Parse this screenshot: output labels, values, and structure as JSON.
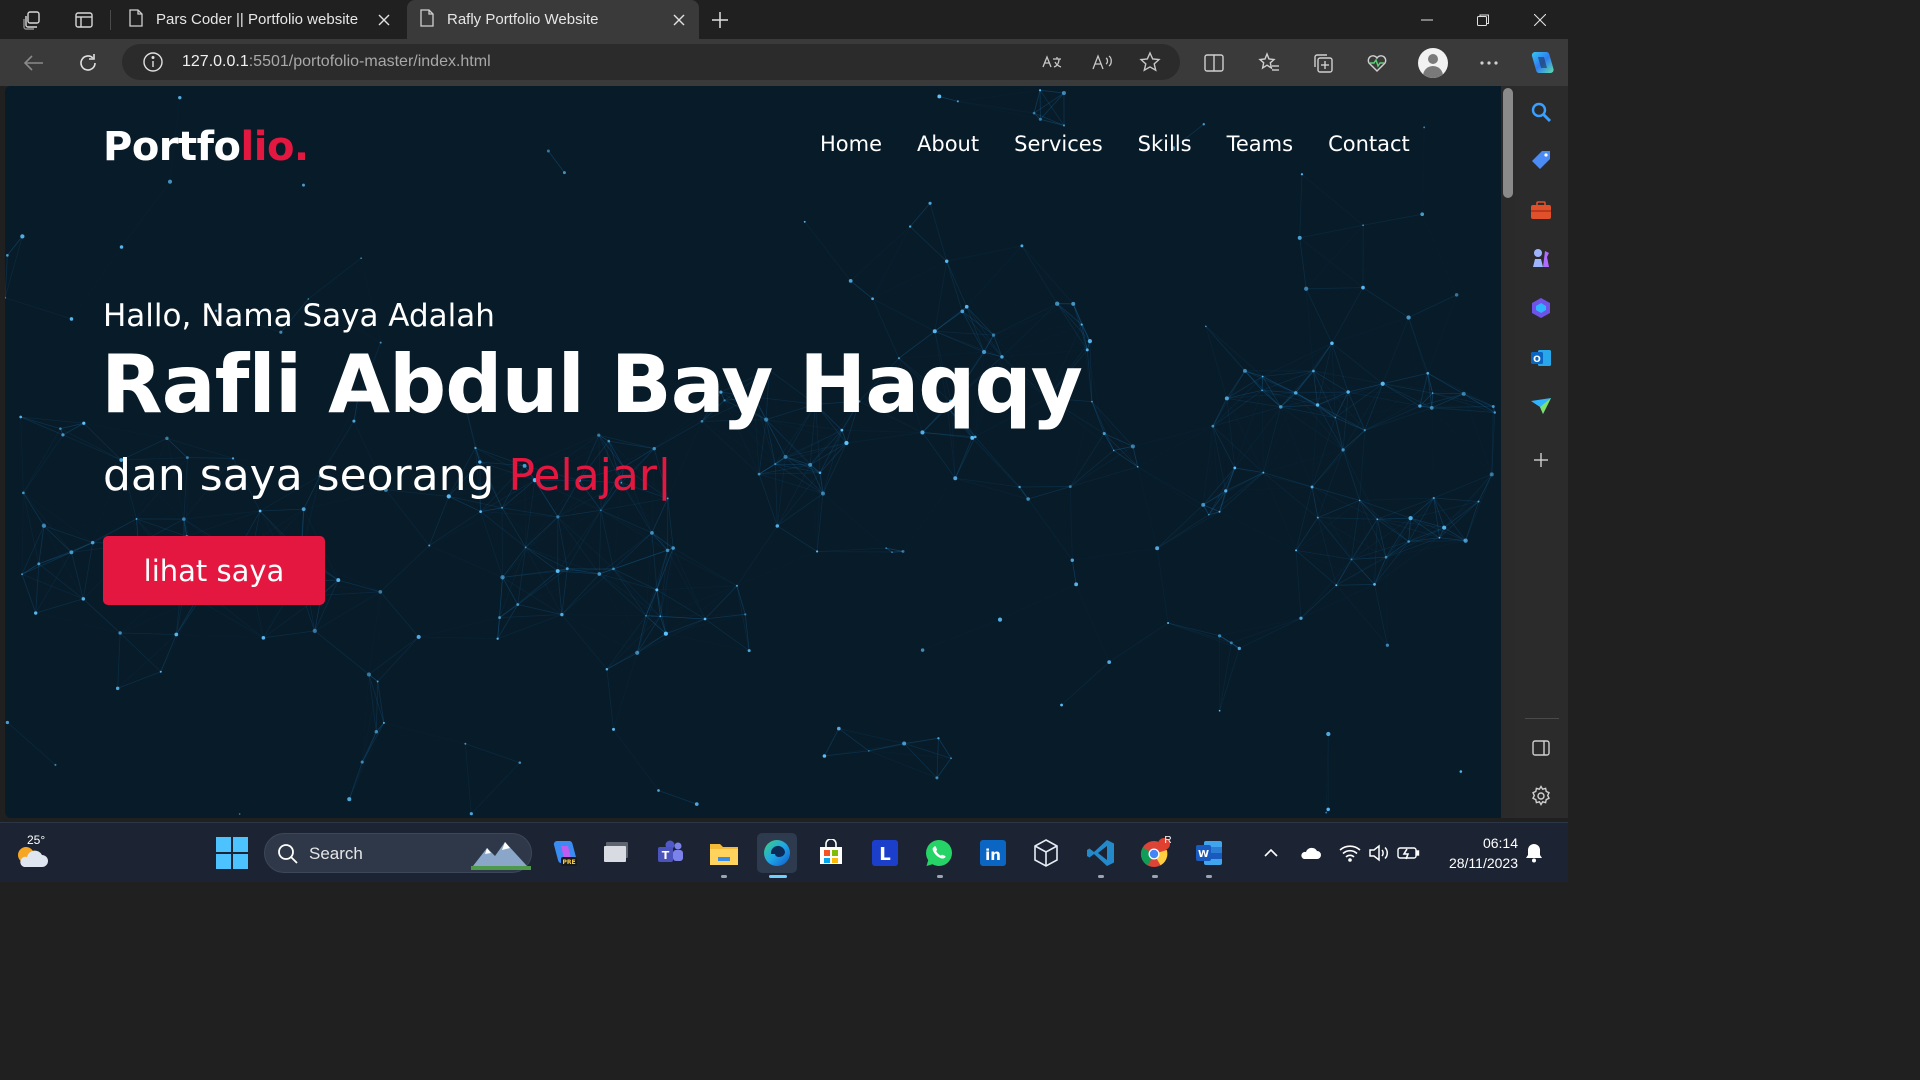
{
  "browser": {
    "tabs": [
      {
        "title": "Pars Coder || Portfolio website",
        "active": false
      },
      {
        "title": "Rafly Portfolio Website",
        "active": true
      }
    ],
    "url_host": "127.0.0.1",
    "url_rest": ":5501/portofolio-master/index.html"
  },
  "site": {
    "logo_main": "Portfo",
    "logo_accent": "lio.",
    "nav": [
      "Home",
      "About",
      "Services",
      "Skills",
      "Teams",
      "Contact"
    ],
    "greeting": "Hallo, Nama Saya Adalah",
    "name": "Rafli Abdul Bay Haqqy",
    "role_prefix": "dan saya seorang",
    "role_typed": "Pelajar",
    "cursor": "|",
    "cta_label": "lihat saya",
    "accent_color": "#e3173f",
    "background_color": "#081b29"
  },
  "taskbar": {
    "weather_temp": "25°",
    "search_label": "Search",
    "time": "06:14",
    "date": "28/11/2023",
    "chrome_badge": "R"
  }
}
